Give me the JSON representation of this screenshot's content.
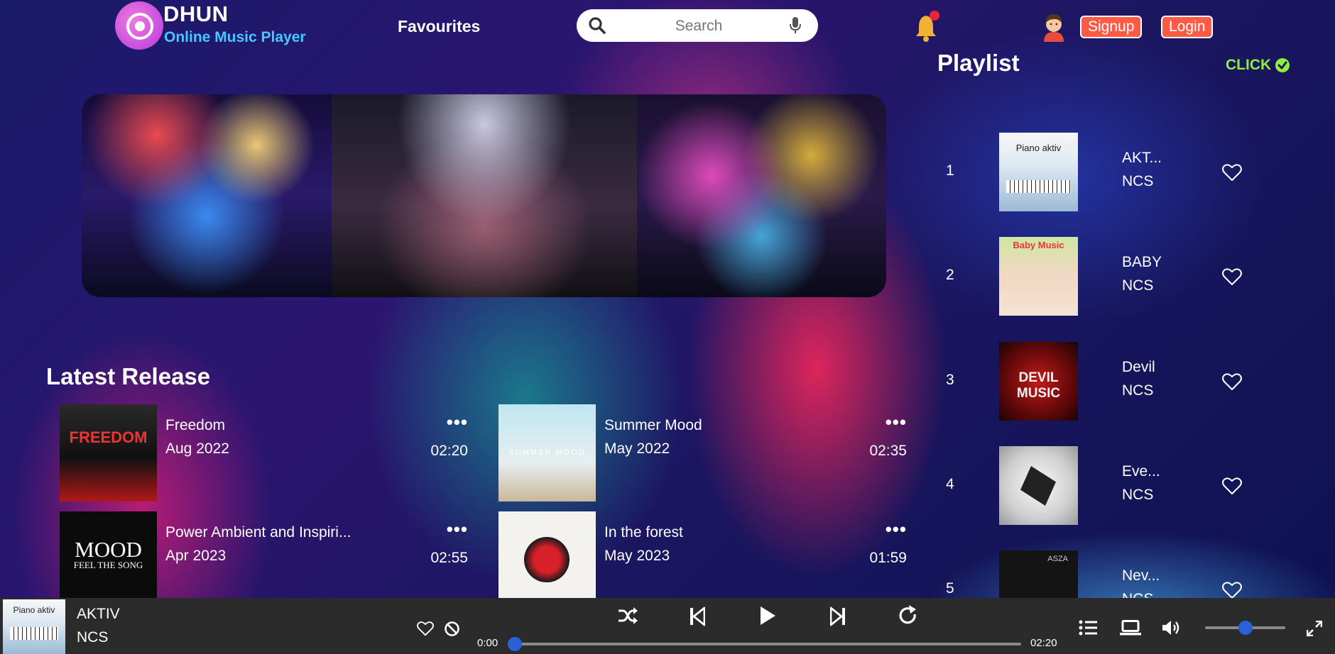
{
  "header": {
    "brand": "DHUN",
    "tagline": "Online Music Player",
    "nav_favourites": "Favourites",
    "search_placeholder": "Search",
    "signup_label": "Signup",
    "login_label": "Login"
  },
  "latest": {
    "title": "Latest Release",
    "items": [
      {
        "title": "Freedom",
        "date": "Aug 2022",
        "duration": "02:20",
        "cover_text": "FREEDOM"
      },
      {
        "title": "Summer Mood",
        "date": "May 2022",
        "duration": "02:35",
        "cover_text": "SUMMER MOOD"
      },
      {
        "title": "Power Ambient and Inspiri...",
        "date": "Apr 2023",
        "duration": "02:55",
        "cover_text_1": "MOOD",
        "cover_text_2": "FEEL THE SONG"
      },
      {
        "title": "In the forest",
        "date": "May 2023",
        "duration": "01:59"
      }
    ]
  },
  "playlist": {
    "title": "Playlist",
    "click_label": "CLICK",
    "items": [
      {
        "num": "1",
        "name": "AKT...",
        "artist": "NCS",
        "cover_text": "Piano aktiv"
      },
      {
        "num": "2",
        "name": "BABY",
        "artist": "NCS",
        "cover_text": "Baby Music"
      },
      {
        "num": "3",
        "name": "Devil",
        "artist": "NCS",
        "cover_text": "DEVIL MUSIC"
      },
      {
        "num": "4",
        "name": "Eve...",
        "artist": "NCS"
      },
      {
        "num": "5",
        "name": "Nev...",
        "artist": "NCS",
        "cover_text": "ASZA"
      }
    ]
  },
  "player": {
    "title": "AKTIV",
    "artist": "NCS",
    "cover_text": "Piano aktiv",
    "current_time": "0:00",
    "total_time": "02:20",
    "progress": 0.0,
    "volume": 0.5
  },
  "colors": {
    "accent": "#2962d6",
    "auth_button": "#ff5a44",
    "tagline": "#44c8ff",
    "click": "#8ef03a",
    "player_bg": "#2b2b2b"
  },
  "icons": [
    "search-icon",
    "mic-icon",
    "bell-icon",
    "avatar",
    "check-circle-icon",
    "heart-icon",
    "block-icon",
    "shuffle-icon",
    "previous-icon",
    "play-icon",
    "next-icon",
    "repeat-icon",
    "queue-icon",
    "device-icon",
    "volume-icon",
    "fullscreen-icon"
  ]
}
